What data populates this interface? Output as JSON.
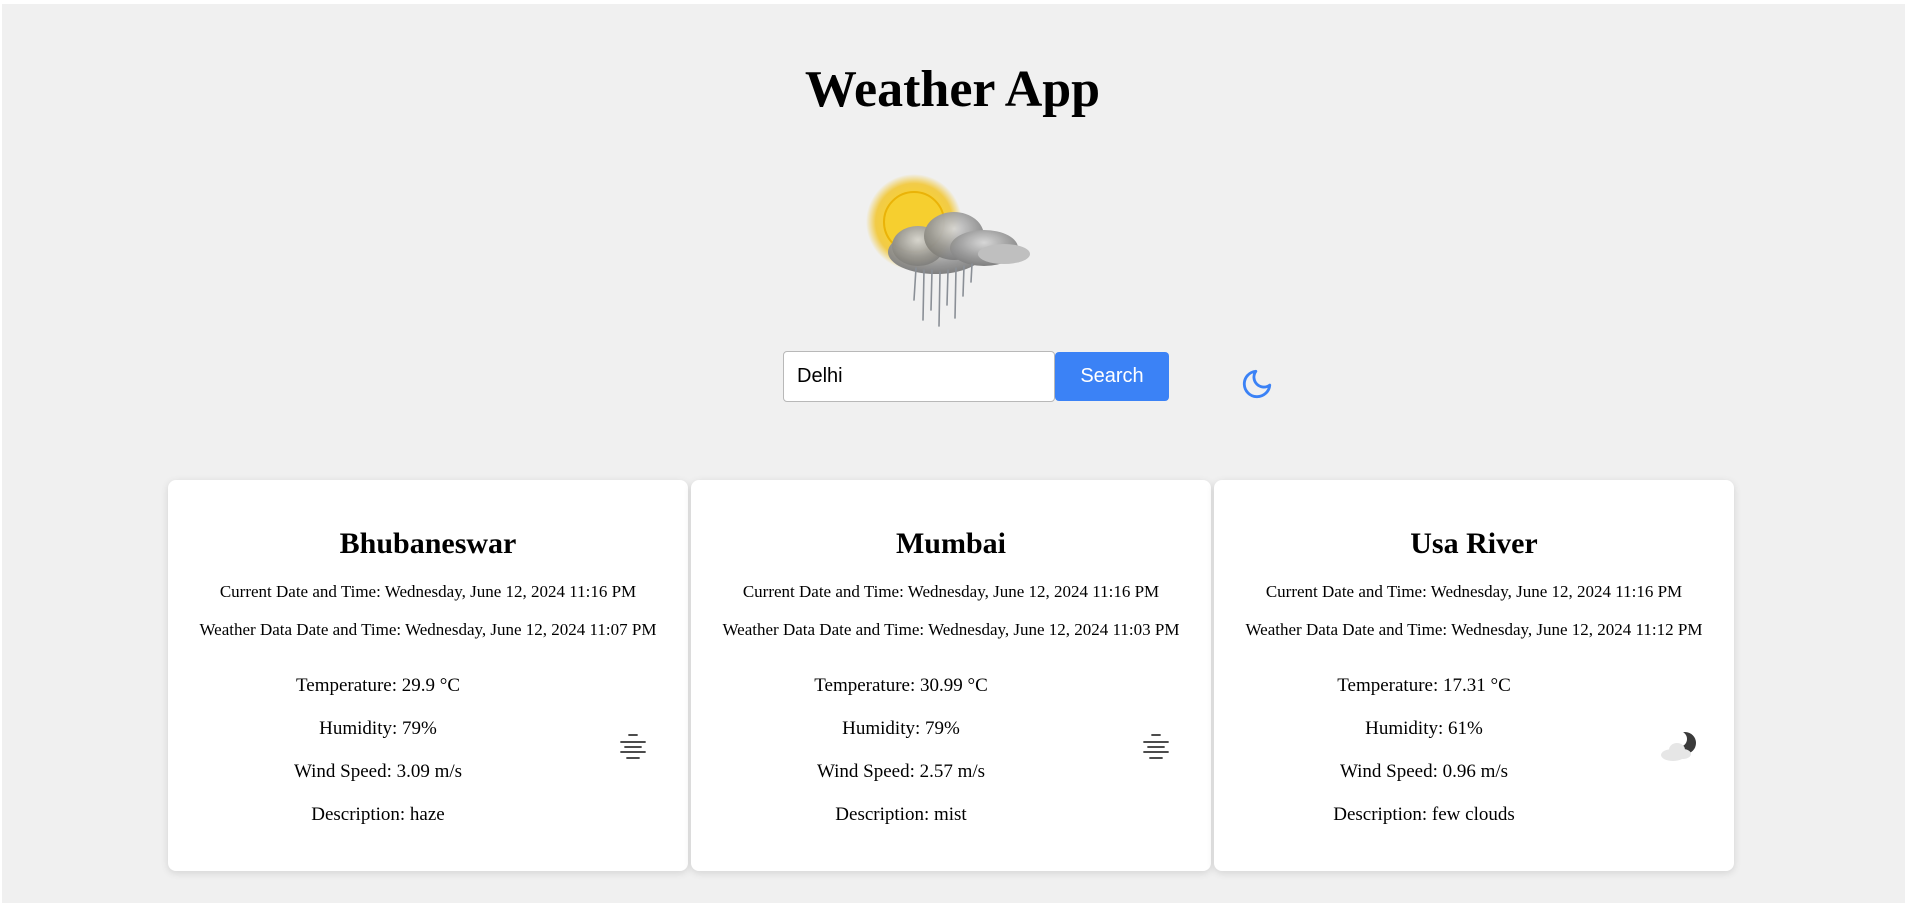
{
  "app": {
    "title": "Weather App"
  },
  "hero": {
    "icon": "sun-cloud-rain-icon"
  },
  "search": {
    "value": "Delhi",
    "button_label": "Search"
  },
  "theme_toggle": {
    "icon": "moon-icon",
    "color": "#3b82f6"
  },
  "colors": {
    "background": "#f0f0f0",
    "accent": "#3b82f6",
    "card": "#ffffff"
  },
  "cards": [
    {
      "city": "Bhubaneswar",
      "current_dt": "Current Date and Time: Wednesday, June 12, 2024 11:16 PM",
      "weather_dt": "Weather Data Date and Time: Wednesday, June 12, 2024 11:07 PM",
      "temperature": "Temperature: 29.9 °C",
      "humidity": "Humidity: 79%",
      "wind": "Wind Speed: 3.09 m/s",
      "description": "Description: haze",
      "icon": "haze-icon"
    },
    {
      "city": "Mumbai",
      "current_dt": "Current Date and Time: Wednesday, June 12, 2024 11:16 PM",
      "weather_dt": "Weather Data Date and Time: Wednesday, June 12, 2024 11:03 PM",
      "temperature": "Temperature: 30.99 °C",
      "humidity": "Humidity: 79%",
      "wind": "Wind Speed: 2.57 m/s",
      "description": "Description: mist",
      "icon": "mist-icon"
    },
    {
      "city": "Usa River",
      "current_dt": "Current Date and Time: Wednesday, June 12, 2024 11:16 PM",
      "weather_dt": "Weather Data Date and Time: Wednesday, June 12, 2024 11:12 PM",
      "temperature": "Temperature: 17.31 °C",
      "humidity": "Humidity: 61%",
      "wind": "Wind Speed: 0.96 m/s",
      "description": "Description: few clouds",
      "icon": "night-few-clouds-icon"
    }
  ]
}
